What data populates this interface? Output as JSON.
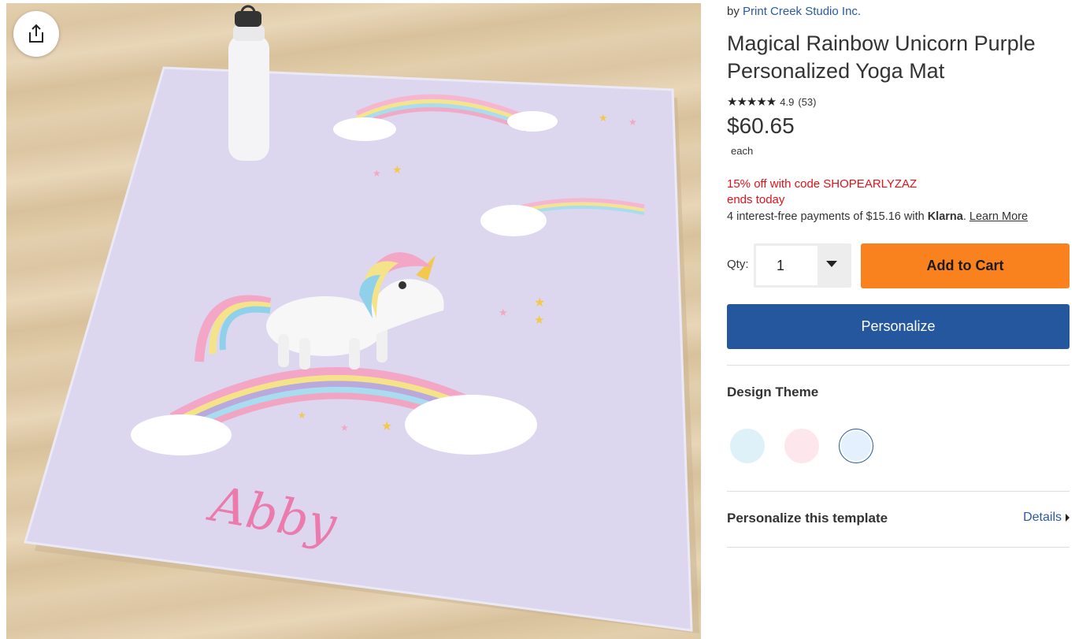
{
  "product_image": {
    "personalized_name": "Abby"
  },
  "share": {
    "icon": "share-icon"
  },
  "byline": {
    "prefix": "by",
    "store": "Print Creek Studio Inc."
  },
  "title": "Magical Rainbow Unicorn Purple Personalized Yoga Mat",
  "rating": {
    "stars": "★★★★★",
    "value": "4.9",
    "count": "(53)"
  },
  "price": {
    "amount": "$60.65",
    "unit": "each"
  },
  "promo": {
    "line1": "15% off with code SHOPEARLYZAZ",
    "line2": "ends today"
  },
  "klarna": {
    "text": "4 interest-free payments of $15.16 with",
    "brand": "Klarna",
    "suffix": ".",
    "link": "Learn More"
  },
  "quantity": {
    "label": "Qty:",
    "value": "1"
  },
  "buttons": {
    "add_to_cart": "Add to Cart",
    "personalize": "Personalize"
  },
  "design_theme": {
    "heading": "Design Theme",
    "swatches": [
      {
        "color": "#dff1f8",
        "selected": false
      },
      {
        "color": "#fde6ec",
        "selected": false
      },
      {
        "color": "#e4f0fd",
        "selected": true
      }
    ]
  },
  "template": {
    "heading": "Personalize this template",
    "details_link": "Details"
  },
  "colors": {
    "accent_orange": "#f9821e",
    "brand_blue": "#25579e",
    "promo_red": "#e0121b",
    "link_blue": "#2b5aa3"
  }
}
